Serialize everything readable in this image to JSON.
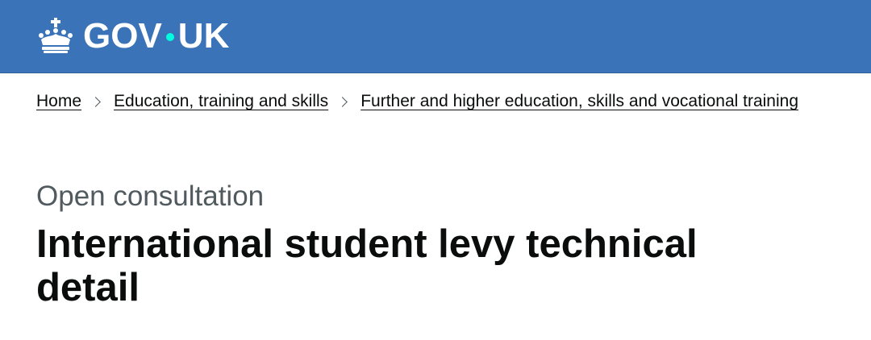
{
  "colors": {
    "brand": "#3a73b7",
    "logo_dot": "#00ffe0",
    "text": "#0b0c0c",
    "secondary_text": "#505a5f"
  },
  "header": {
    "logo_text_left": "GOV",
    "logo_text_right": "UK",
    "logo_icon": "crown-icon"
  },
  "breadcrumbs": {
    "items": [
      {
        "label": "Home"
      },
      {
        "label": "Education, training and skills"
      },
      {
        "label": "Further and higher education, skills and vocational training"
      }
    ],
    "separator_icon": "chevron-right-icon"
  },
  "page": {
    "caption": "Open consultation",
    "title": "International student levy technical detail"
  }
}
